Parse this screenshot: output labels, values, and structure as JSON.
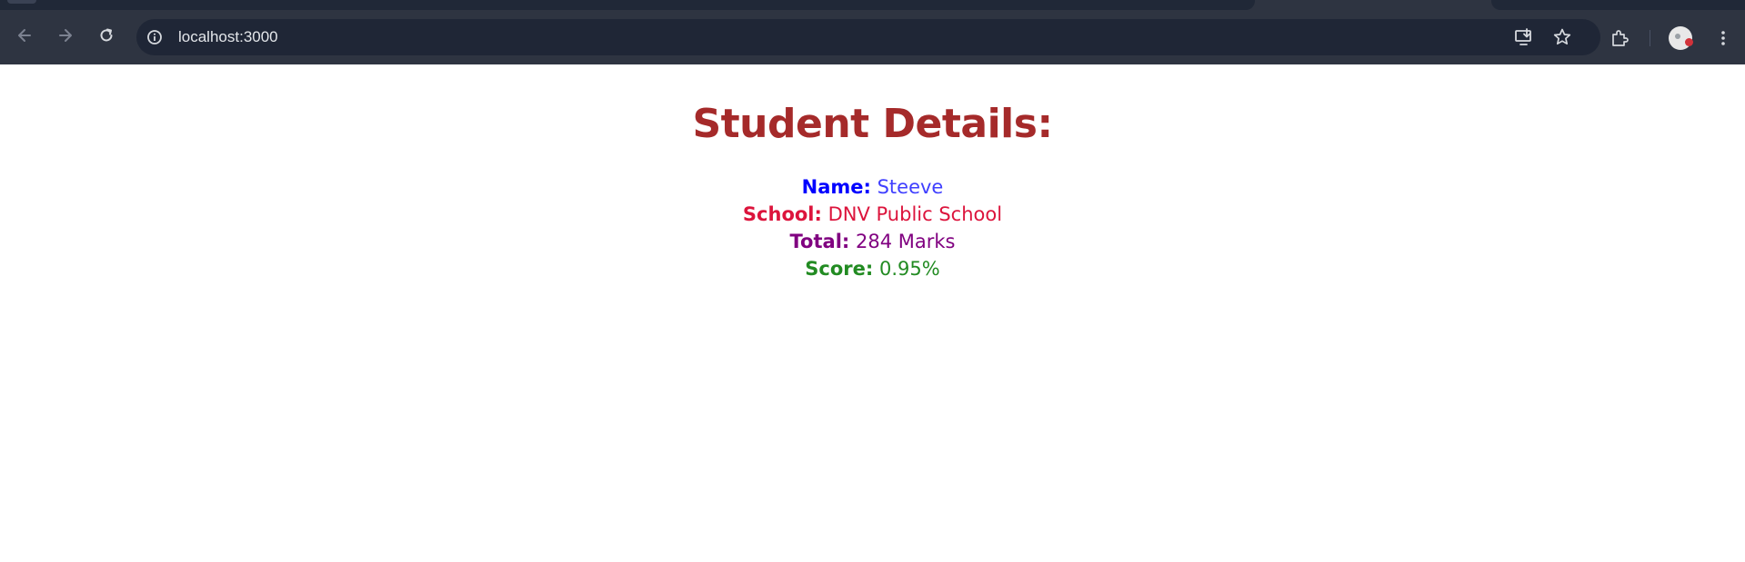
{
  "browser": {
    "url": "localhost:3000",
    "icons": [
      "back-arrow-icon",
      "forward-arrow-icon",
      "reload-icon",
      "site-info-icon",
      "install-app-icon",
      "star-icon",
      "extensions-icon",
      "profile-avatar",
      "more-menu-icon"
    ]
  },
  "page": {
    "title": "Student Details:",
    "details": {
      "name_label": "Name:",
      "name_value": "Steeve",
      "school_label": "School:",
      "school_value": "DNV Public School",
      "total_label": "Total:",
      "total_value": "284 Marks",
      "score_label": "Score:",
      "score_value": "0.95%"
    }
  },
  "colors": {
    "title": "#a52a2a",
    "name": "#0000ff",
    "school": "#dc143c",
    "total": "#800080",
    "score": "#228b22"
  }
}
